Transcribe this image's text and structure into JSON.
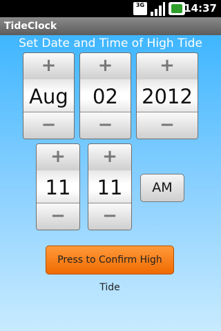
{
  "status_bar": {
    "network": "3G",
    "time": "14:37",
    "icons": [
      "3g-icon",
      "signal-icon",
      "battery-icon"
    ]
  },
  "app": {
    "title": "TideClock"
  },
  "heading": "Set Date and Time of High Tide",
  "spinners": {
    "plus_symbol": "+",
    "minus_symbol": "−",
    "month": "Aug",
    "day": "02",
    "year": "2012",
    "hour": "11",
    "minute": "11"
  },
  "ampm_button": "AM",
  "confirm_button": "Press to Confirm High Tide",
  "colors": {
    "background_top": "#3fb6ff",
    "confirm_orange": "#f06a00"
  }
}
